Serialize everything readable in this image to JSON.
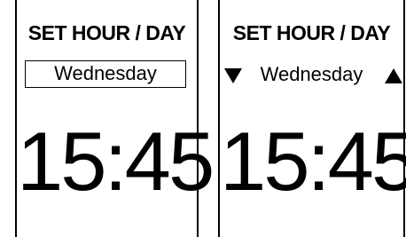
{
  "left_screen": {
    "title": "SET HOUR / DAY",
    "day": "Wednesday",
    "time": "15:45"
  },
  "right_screen": {
    "title": "SET HOUR / DAY",
    "day": "Wednesday",
    "time": "15:45",
    "decrement_icon": "triangle-down-icon",
    "increment_icon": "triangle-up-icon"
  }
}
